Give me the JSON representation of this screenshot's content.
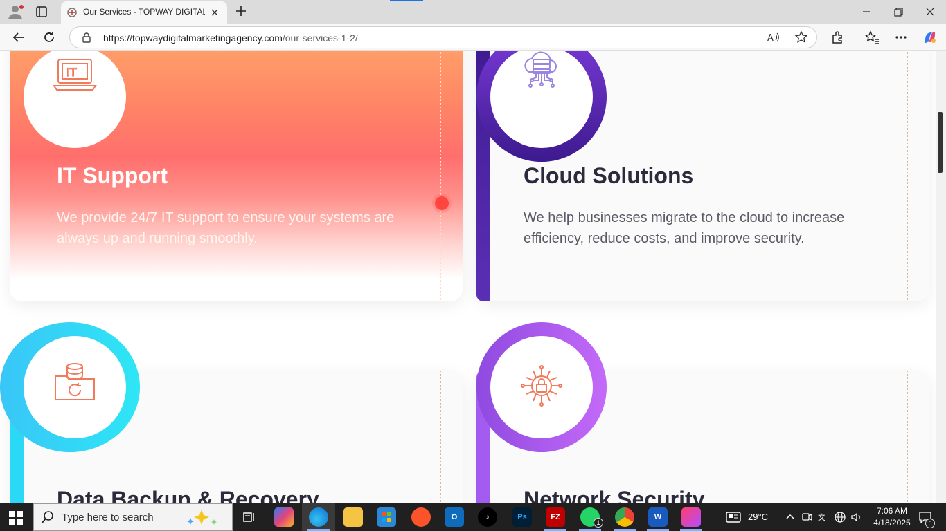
{
  "browser": {
    "tab_title": "Our Services - TOPWAY DIGITAL MARKETING AGENCY",
    "url_host": "https://topwaydigitalmarketingagency.com",
    "url_path": "/our-services-1-2/"
  },
  "services": [
    {
      "title": "IT Support",
      "description": "We provide 24/7 IT support to ensure your systems are always up and running smoothly.",
      "icon": "it-laptop-icon",
      "theme": "coral-gradient"
    },
    {
      "title": "Cloud Solutions",
      "description": "We help businesses migrate to the cloud to increase efficiency, reduce costs, and improve security.",
      "icon": "cloud-server-icon",
      "ring_color": "#5b2fb5"
    },
    {
      "title": "Data Backup & Recovery",
      "description": "",
      "icon": "database-folder-icon",
      "ring_color": "#2bd8f5"
    },
    {
      "title": "Network Security",
      "description": "",
      "icon": "circuit-lock-icon",
      "ring_color": "#a45cf0"
    }
  ],
  "taskbar": {
    "search_placeholder": "Type here to search",
    "weather": "29°C",
    "time": "7:06 AM",
    "date": "4/18/2025",
    "whatsapp_badge": "1",
    "notifications_badge": "6",
    "apps": [
      "task-view",
      "copilot",
      "edge",
      "file-explorer",
      "microsoft-store",
      "brave",
      "outlook",
      "tiktok",
      "photoshop",
      "filezilla",
      "whatsapp",
      "chrome",
      "word",
      "creative-cloud"
    ]
  },
  "colors": {
    "title_dark": "#2b2b3c",
    "body_text": "#5a5a66",
    "accent_purple": "#5b2fb5",
    "accent_cyan": "#2bd8f5",
    "accent_violet": "#a45cf0",
    "icon_coral": "#f07a5a"
  }
}
